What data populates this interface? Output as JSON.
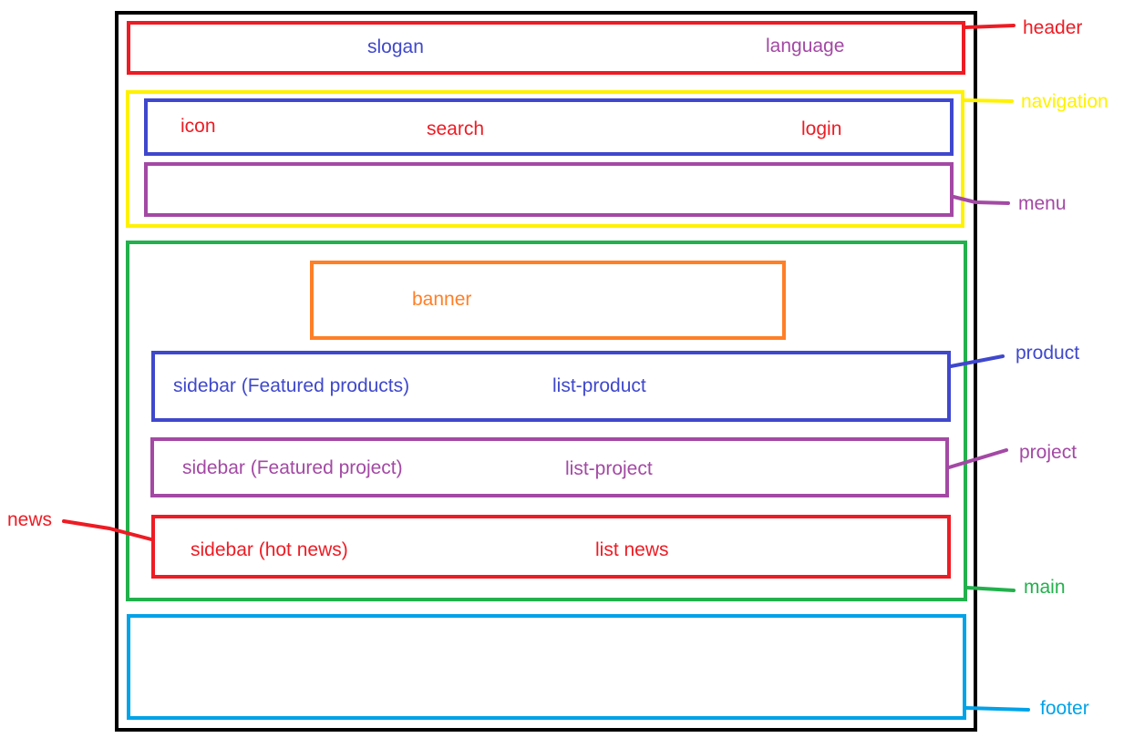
{
  "colors": {
    "outer": "#000000",
    "header": "#ed1c24",
    "navigation": "#fff200",
    "nav_bar": "#3f48cc",
    "menu": "#a349a4",
    "main": "#22b14c",
    "banner": "#ff7f27",
    "product": "#3f48cc",
    "project": "#a349a4",
    "news": "#ed1c24",
    "footer": "#00a2e8"
  },
  "header": {
    "slogan": "slogan",
    "language": "language"
  },
  "navigation": {
    "icon": "icon",
    "search": "search",
    "login": "login"
  },
  "main": {
    "banner": "banner",
    "product": {
      "sidebar": "sidebar (Featured products)",
      "list": "list-product"
    },
    "project": {
      "sidebar": "sidebar (Featured project)",
      "list": "list-project"
    },
    "news": {
      "sidebar": "sidebar (hot news)",
      "list": "list news"
    }
  },
  "annotations": {
    "header": "header",
    "navigation": "navigation",
    "menu": "menu",
    "product": "product",
    "project": "project",
    "news": "news",
    "main": "main",
    "footer": "footer"
  }
}
